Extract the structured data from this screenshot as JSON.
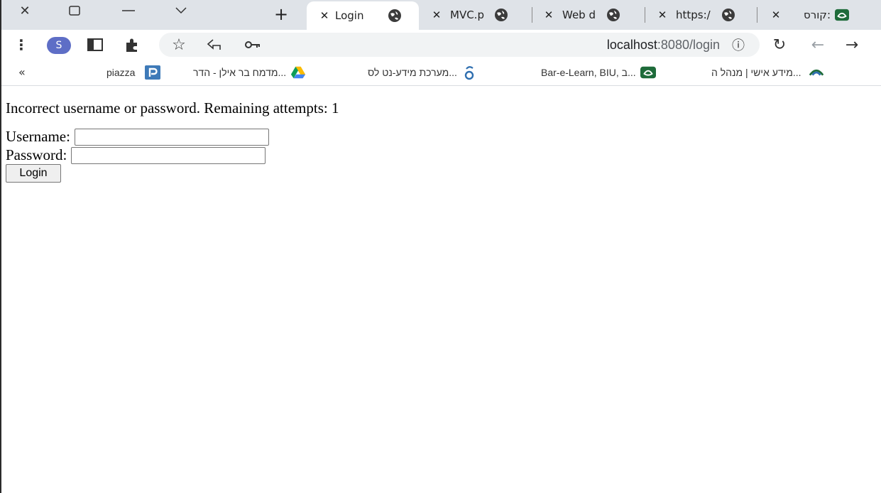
{
  "window_controls": {
    "close_glyph": "✕",
    "maximize_glyph": "☐",
    "minimize_glyph": "—",
    "menu_glyph": "⌄"
  },
  "tabs": [
    {
      "label": "Login",
      "close": "✕",
      "icon": "globe-icon",
      "active": true
    },
    {
      "label": "MVC.p",
      "close": "✕",
      "icon": "globe-icon",
      "active": false
    },
    {
      "label": "Web d",
      "close": "✕",
      "icon": "globe-icon",
      "active": false
    },
    {
      "label": "https:/",
      "close": "✕",
      "icon": "globe-icon",
      "active": false
    },
    {
      "label": "קורס:",
      "close": "✕",
      "icon": "moodle-icon",
      "active": false
    }
  ],
  "new_tab_glyph": "+",
  "toolbar": {
    "menu_glyph": "⋮",
    "avatar_letter": "S",
    "url_host": "localhost",
    "url_path": ":8080/login",
    "info_glyph": "ⓘ",
    "reload_glyph": "↻",
    "back_glyph": "←",
    "forward_glyph": "→",
    "star_glyph": "☆",
    "key_glyph": "⚿"
  },
  "bookmarks": {
    "more_glyph": "«",
    "items": [
      {
        "label": "מידע אישי | מנהל ה...",
        "icon": "biu-icon"
      },
      {
        "label": "Bar-e-Learn, BIU, ב...",
        "icon": "moodle-icon"
      },
      {
        "label": "מערכת מידע-נט לס...",
        "icon": "infonet-icon"
      },
      {
        "label": "מדמח בר אילן - הדר...",
        "icon": "google-drive-icon"
      },
      {
        "label": "piazza",
        "icon": "piazza-icon"
      }
    ]
  },
  "page": {
    "error_message": "Incorrect username or password. Remaining attempts: 1",
    "username_label": "Username:",
    "password_label": "Password:",
    "username_value": "",
    "password_value": "",
    "login_button": "Login"
  },
  "colors": {
    "tabstrip_bg": "#dfe3e8",
    "avatar_bg": "#5e6ec6",
    "moodle_green": "#1e6b3a",
    "piazza_blue": "#3e7ab8"
  }
}
